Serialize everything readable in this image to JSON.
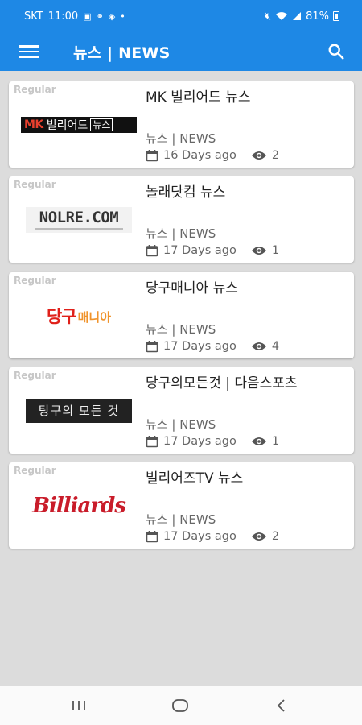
{
  "status_bar": {
    "carrier": "SKT",
    "time": "11:00",
    "battery": "81%"
  },
  "app_bar": {
    "title": "뉴스 | NEWS"
  },
  "colors": {
    "primary": "#1e88e5",
    "background": "#dcdcdc"
  },
  "items": [
    {
      "tag": "Regular",
      "logo_text": [
        "MK",
        "빌리어드",
        "뉴스"
      ],
      "title": "MK 빌리어드 뉴스",
      "category": "뉴스 | NEWS",
      "date": "16 Days ago",
      "views": "2"
    },
    {
      "tag": "Regular",
      "logo_text": [
        "NOLRE.COM"
      ],
      "title": "놀래닷컴 뉴스",
      "category": "뉴스 | NEWS",
      "date": "17 Days ago",
      "views": "1"
    },
    {
      "tag": "Regular",
      "logo_text": [
        "당구",
        "매니아"
      ],
      "title": "당구매니아 뉴스",
      "category": "뉴스 | NEWS",
      "date": "17 Days ago",
      "views": "4"
    },
    {
      "tag": "Regular",
      "logo_text": [
        "탕구의 모든 것"
      ],
      "title": "당구의모든것 | 다음스포츠",
      "category": "뉴스 | NEWS",
      "date": "17 Days ago",
      "views": "1"
    },
    {
      "tag": "Regular",
      "logo_text": [
        "Billiards"
      ],
      "title": "빌리어즈TV 뉴스",
      "category": "뉴스 | NEWS",
      "date": "17 Days ago",
      "views": "2"
    }
  ],
  "icons": {
    "menu": "menu-icon",
    "search": "search-icon",
    "calendar": "calendar-icon",
    "views": "eye-icon",
    "nav_recents": "recents-icon",
    "nav_home": "home-icon",
    "nav_back": "back-icon"
  }
}
